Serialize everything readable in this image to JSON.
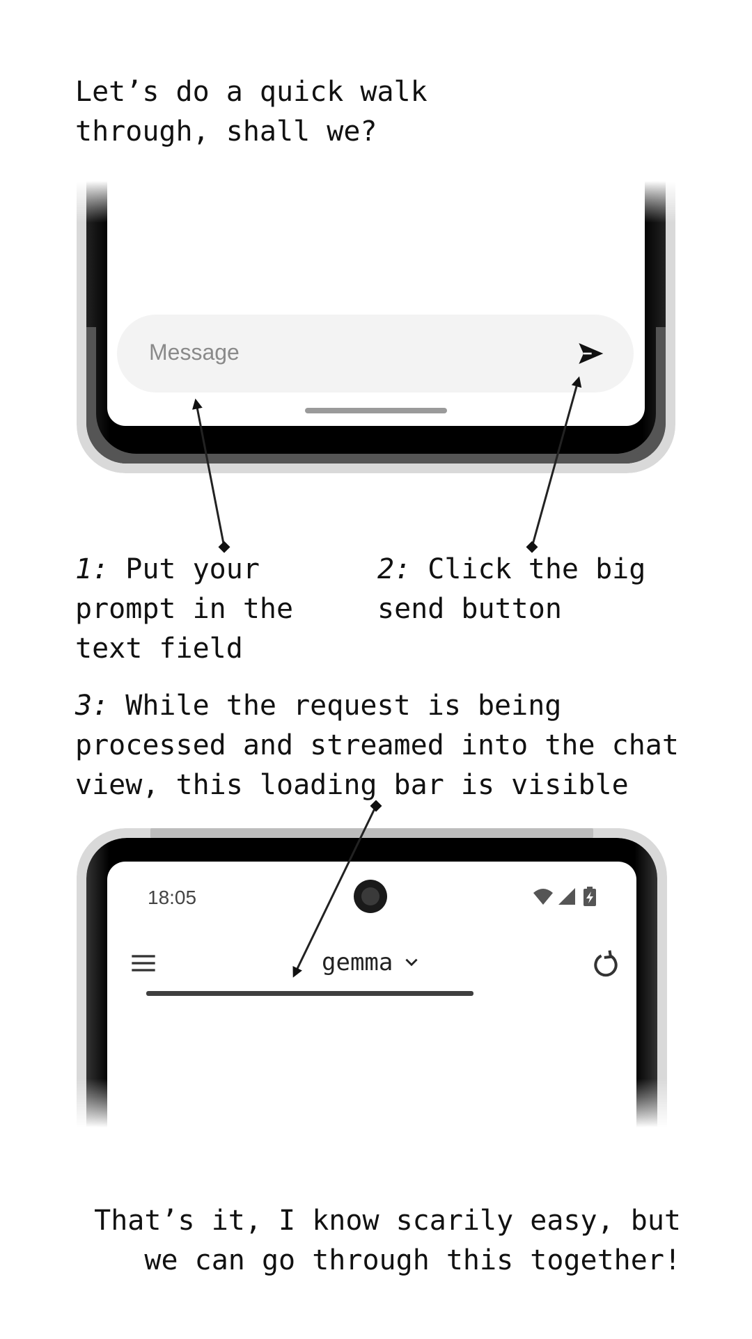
{
  "intro": "Let’s do a quick walk\nthrough, shall we?",
  "composer": {
    "placeholder": "Message",
    "send_icon": "send-icon"
  },
  "steps": [
    {
      "number": "1:",
      "text": " Put your\nprompt in the\ntext field"
    },
    {
      "number": "2:",
      "text": " Click the big\nsend button"
    },
    {
      "number": "3:",
      "text": " While the request is being\nprocessed and streamed into the chat\nview, this loading bar is visible"
    }
  ],
  "status_bar": {
    "time": "18:05",
    "icons": [
      "wifi-icon",
      "signal-icon",
      "battery-charging-icon"
    ]
  },
  "toolbar": {
    "menu_icon": "menu-icon",
    "model_name": "gemma",
    "dropdown_icon": "chevron-down-icon",
    "reset_icon": "reset-icon"
  },
  "outro": "That’s it, I know scarily easy, but\nwe can go through this together!"
}
